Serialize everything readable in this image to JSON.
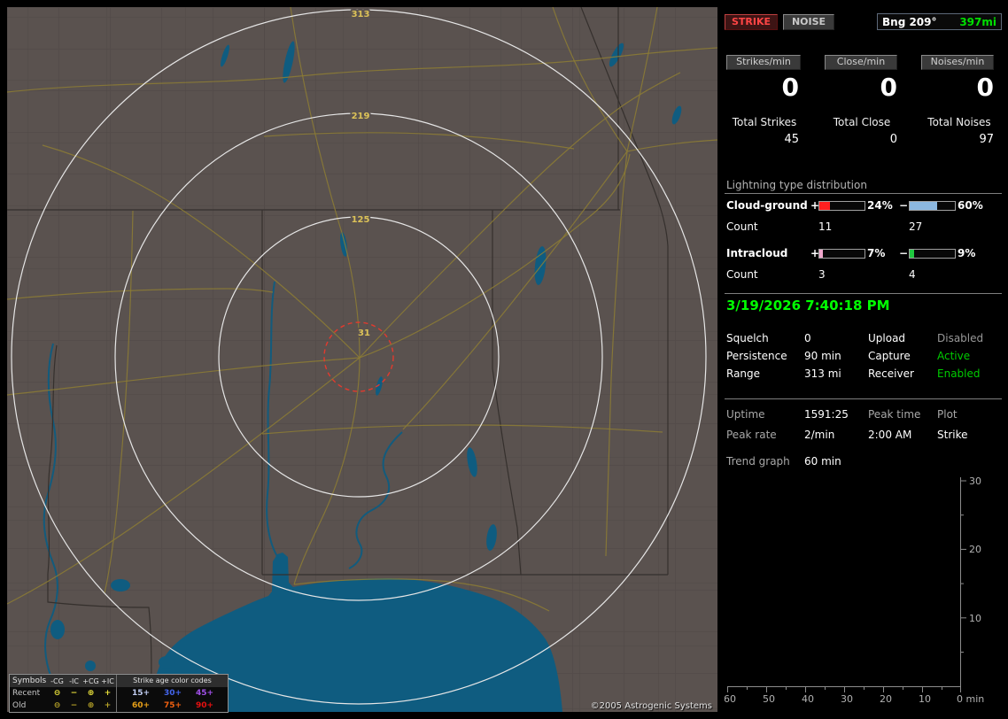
{
  "map": {
    "ring_labels": [
      "313",
      "219",
      "125",
      "31"
    ],
    "copyright": "©2005 Astrogenic Systems",
    "legend": {
      "symbols_title": "Symbols",
      "columns": [
        "-CG",
        "-IC",
        "+CG",
        "+IC"
      ],
      "age_title": "Strike age color codes",
      "symbol_glyphs": [
        "⊖",
        "−",
        "⊕",
        "+"
      ],
      "recent_symbol_color": "#e8e03a",
      "old_symbol_color": "#b8a428",
      "rows": [
        {
          "label": "Recent",
          "ages": [
            {
              "text": "15+",
              "color": "#c0ccf0"
            },
            {
              "text": "30+",
              "color": "#4466ee"
            },
            {
              "text": "45+",
              "color": "#a050e8"
            }
          ]
        },
        {
          "label": "Old",
          "ages": [
            {
              "text": "60+",
              "color": "#e8a018"
            },
            {
              "text": "75+",
              "color": "#f06010"
            },
            {
              "text": "90+",
              "color": "#e81010"
            }
          ]
        }
      ]
    }
  },
  "panel": {
    "strike_button": "STRIKE",
    "strike_color": "#ff4545",
    "noise_button": "NOISE",
    "bearing": {
      "label": "Bng 209°",
      "range": "397mi",
      "range_color": "#00e000"
    },
    "rates": [
      {
        "label": "Strikes/min",
        "value": "0"
      },
      {
        "label": "Close/min",
        "value": "0"
      },
      {
        "label": "Noises/min",
        "value": "0"
      }
    ],
    "totals": [
      {
        "label": "Total Strikes",
        "value": "45"
      },
      {
        "label": "Total Close",
        "value": "0"
      },
      {
        "label": "Total Noises",
        "value": "97"
      }
    ],
    "distribution": {
      "title": "Lightning type distribution",
      "plus_sign": "+",
      "minus_sign": "−",
      "rows": [
        {
          "label": "Cloud-ground",
          "pos_pct": "24%",
          "pos_width": "24%",
          "pos_color": "#ff2020",
          "neg_pct": "60%",
          "neg_width": "60%",
          "neg_color": "#8cb8e0",
          "count_label": "Count",
          "pos_count": "11",
          "neg_count": "27"
        },
        {
          "label": "Intracloud",
          "pos_pct": "7%",
          "pos_width": "7%",
          "pos_color": "#f0a8cc",
          "neg_pct": "9%",
          "neg_width": "9%",
          "neg_color": "#20c840",
          "count_label": "Count",
          "pos_count": "3",
          "neg_count": "4"
        }
      ]
    },
    "clock": {
      "text": "3/19/2026 7:40:18 PM",
      "color": "#00ff00"
    },
    "status": [
      {
        "label": "Squelch",
        "value": "0",
        "color": "#ffffff"
      },
      {
        "label": "Upload",
        "value": "Disabled",
        "color": "#989898"
      },
      {
        "label": "Persistence",
        "value": "90 min",
        "color": "#ffffff"
      },
      {
        "label": "Capture",
        "value": "Active",
        "color": "#00cc00"
      },
      {
        "label": "Range",
        "value": "313 mi",
        "color": "#ffffff"
      },
      {
        "label": "Receiver",
        "value": "Enabled",
        "color": "#00cc00"
      }
    ],
    "stats": {
      "uptime_label": "Uptime",
      "uptime": "1591:25",
      "peak_time_label": "Peak time",
      "peak_time": "2:00 AM",
      "plot_label": "Plot",
      "plot": "Strike",
      "peak_rate_label": "Peak rate",
      "peak_rate": "2/min"
    },
    "trend": {
      "label": "Trend graph",
      "value": "60 min",
      "y_ticks": [
        "30",
        "20",
        "10"
      ],
      "x_ticks": [
        "60",
        "50",
        "40",
        "30",
        "20",
        "10"
      ],
      "x_last": "0 min"
    }
  }
}
